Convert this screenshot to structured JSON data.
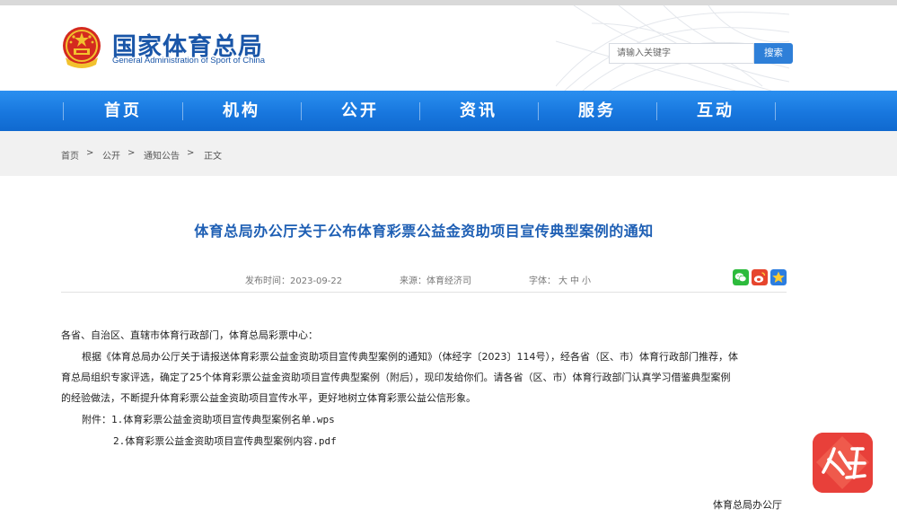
{
  "header": {
    "title_cn": "国家体育总局",
    "title_en": "General Administration of Sport of China"
  },
  "search": {
    "placeholder": "请输入关键字",
    "button_label": "搜索"
  },
  "nav": {
    "items": [
      "首页",
      "机构",
      "公开",
      "资讯",
      "服务",
      "互动"
    ]
  },
  "breadcrumb": {
    "items": [
      "首页",
      "公开",
      "通知公告",
      "正文"
    ],
    "separator": ">"
  },
  "article": {
    "title": "体育总局办公厅关于公布体育彩票公益金资助项目宣传典型案例的通知",
    "publish_time": "发布时间：2023-09-22",
    "source": "来源：体育经济司",
    "font_size_label": "字体：",
    "font_sizes": [
      "大",
      "中",
      "小"
    ],
    "salutation": "各省、自治区、直辖市体育行政部门，体育总局彩票中心：",
    "para1_line1": "根据《体育总局办公厅关于请报送体育彩票公益金资助项目宣传典型案例的通知》（体经字〔2023〕114号），经各省（区、市）体育行政部门推荐，体",
    "para1_line2": "育总局组织专家评选，确定了25个体育彩票公益金资助项目宣传典型案例（附后），现印发给你们。请各省（区、市）体育行政部门认真学习借鉴典型案例",
    "para1_line3": "的经验做法，不断提升体育彩票公益金资助项目宣传水平，更好地树立体育彩票公益公信形象。",
    "attachment1": "附件：1.体育彩票公益金资助项目宣传典型案例名单.wps",
    "attachment2": "2.体育彩票公益金资助项目宣传典型案例内容.pdf",
    "signature": "体育总局办公厅"
  },
  "colors": {
    "brand_blue": "#1a56a8",
    "nav_blue": "#1877de",
    "title_blue": "#1e5fb4",
    "badge_red": "#e8403a"
  },
  "icons": {
    "share": [
      "wechat-icon",
      "weibo-icon",
      "qzone-icon"
    ],
    "floating": "app-badge-icon"
  }
}
